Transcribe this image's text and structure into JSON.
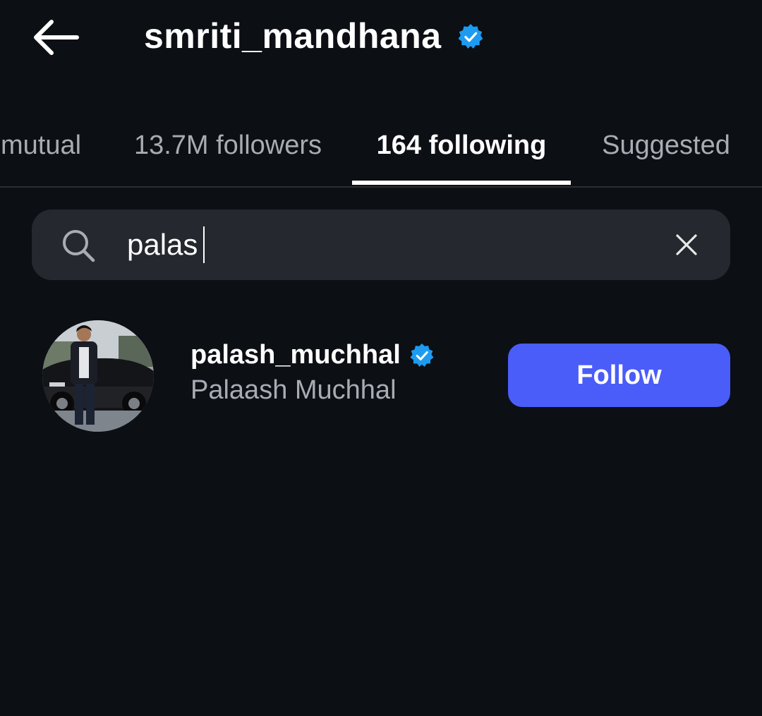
{
  "header": {
    "title": "smriti_mandhana",
    "verified_icon": "verified-badge-icon",
    "back_icon": "arrow-left-icon"
  },
  "tabs": [
    {
      "label": "mutual",
      "active": false
    },
    {
      "label": "13.7M followers",
      "active": false
    },
    {
      "label": "164 following",
      "active": true
    },
    {
      "label": "Suggested",
      "active": false
    }
  ],
  "search": {
    "value": "palas",
    "search_icon": "search-icon",
    "clear_icon": "close-icon"
  },
  "results": [
    {
      "username": "palash_muchhal",
      "full_name": "Palaash Muchhal",
      "verified": true,
      "button_label": "Follow"
    }
  ],
  "colors": {
    "background": "#0c0f14",
    "search_background": "#25282e",
    "verified_blue": "#1d9bf0",
    "follow_button": "#4a5df9",
    "secondary_text": "#a8acb3"
  }
}
